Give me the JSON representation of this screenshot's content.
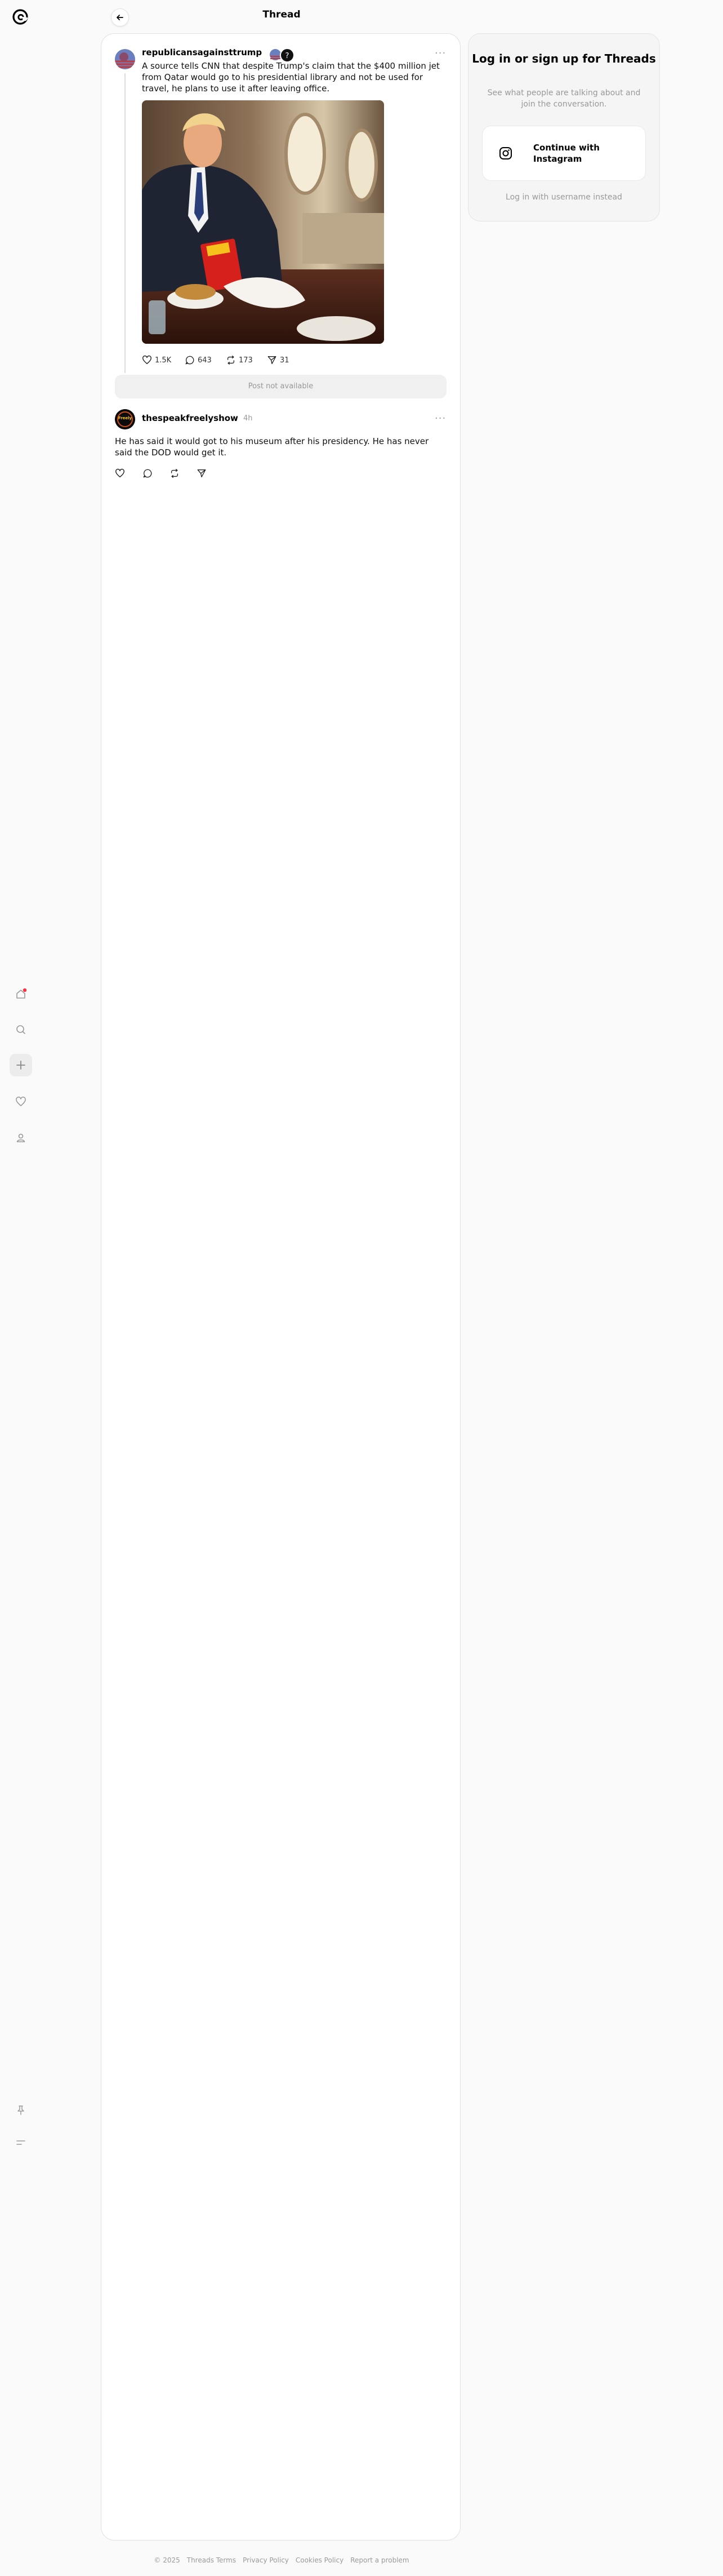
{
  "header": {
    "title": "Thread"
  },
  "nav": {
    "items": [
      {
        "icon": "home-icon"
      },
      {
        "icon": "search-icon"
      },
      {
        "icon": "plus-icon"
      },
      {
        "icon": "heart-icon"
      },
      {
        "icon": "profile-icon"
      }
    ],
    "bottom": [
      {
        "icon": "pin-icon"
      },
      {
        "icon": "menu-icon"
      }
    ]
  },
  "post": {
    "username": "republicansagainsttrump",
    "text": "A source tells CNN that despite Trump's claim that the $400 million jet from Qatar would go to his presidential library and not be used for travel, he plans to use it after leaving office.",
    "likes": "1.5K",
    "replies": "643",
    "reposts": "173",
    "shares": "31"
  },
  "unavailable": {
    "text": "Post not available"
  },
  "reply": {
    "username": "thespeakfreelyshow",
    "avatar_text": "Freely",
    "time": "4h",
    "text": "He has said it would got to his museum after his presidency. He has never said the DOD would get it."
  },
  "login": {
    "title": "Log in or sign up for Threads",
    "subtitle": "See what people are talking about and join the conversation.",
    "instagram_button": "Continue with Instagram",
    "username_link": "Log in with username instead"
  },
  "footer": {
    "copyright": "© 2025",
    "links": [
      "Threads Terms",
      "Privacy Policy",
      "Cookies Policy",
      "Report a problem"
    ]
  },
  "colors": {
    "accent": "#ff3040",
    "border": "#e0e0e0",
    "muted": "#999999"
  }
}
